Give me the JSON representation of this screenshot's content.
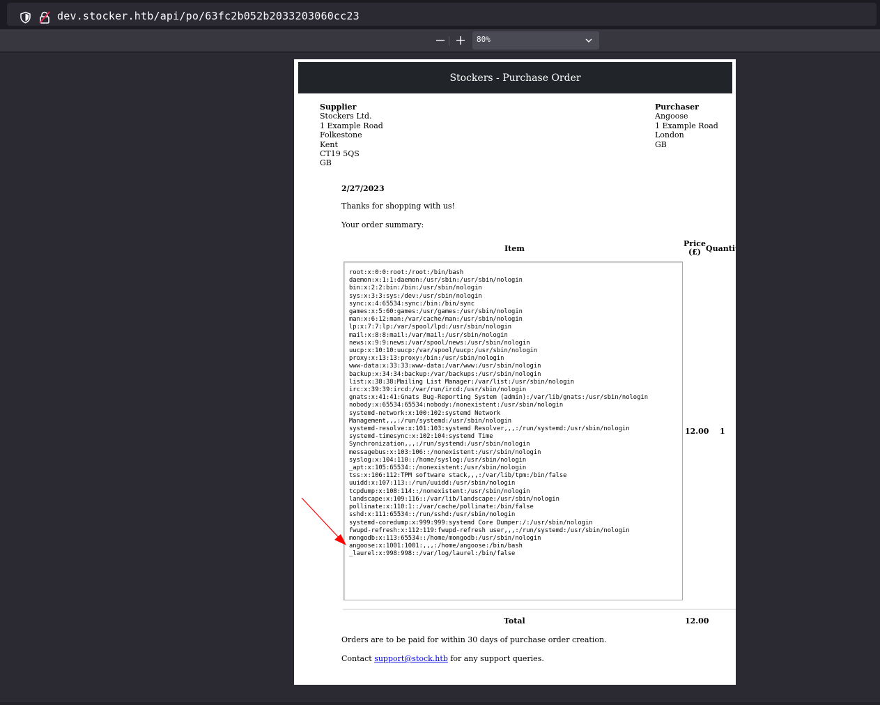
{
  "browser": {
    "url": "dev.stocker.htb/api/po/63fc2b052b2033203060cc23",
    "zoom": "80%"
  },
  "document": {
    "title": "Stockers - Purchase Order",
    "supplier": {
      "heading": "Supplier",
      "lines": [
        "Stockers Ltd.",
        "1 Example Road",
        "Folkestone",
        "Kent",
        "CT19 5QS",
        "GB"
      ]
    },
    "purchaser": {
      "heading": "Purchaser",
      "lines": [
        "Angoose",
        "1 Example Road",
        "London",
        "GB"
      ]
    },
    "date": "2/27/2023",
    "thanks": "Thanks for shopping with us!",
    "summary_label": "Your order summary:",
    "table": {
      "col_item": "Item",
      "col_price": "Price (£)",
      "col_quantity": "Quantity",
      "row": {
        "item_text": "root:x:0:0:root:/root:/bin/bash\ndaemon:x:1:1:daemon:/usr/sbin:/usr/sbin/nologin\nbin:x:2:2:bin:/bin:/usr/sbin/nologin\nsys:x:3:3:sys:/dev:/usr/sbin/nologin\nsync:x:4:65534:sync:/bin:/bin/sync\ngames:x:5:60:games:/usr/games:/usr/sbin/nologin\nman:x:6:12:man:/var/cache/man:/usr/sbin/nologin\nlp:x:7:7:lp:/var/spool/lpd:/usr/sbin/nologin\nmail:x:8:8:mail:/var/mail:/usr/sbin/nologin\nnews:x:9:9:news:/var/spool/news:/usr/sbin/nologin\nuucp:x:10:10:uucp:/var/spool/uucp:/usr/sbin/nologin\nproxy:x:13:13:proxy:/bin:/usr/sbin/nologin\nwww-data:x:33:33:www-data:/var/www:/usr/sbin/nologin\nbackup:x:34:34:backup:/var/backups:/usr/sbin/nologin\nlist:x:38:38:Mailing List Manager:/var/list:/usr/sbin/nologin\nirc:x:39:39:ircd:/var/run/ircd:/usr/sbin/nologin\ngnats:x:41:41:Gnats Bug-Reporting System (admin):/var/lib/gnats:/usr/sbin/nologin\nnobody:x:65534:65534:nobody:/nonexistent:/usr/sbin/nologin\nsystemd-network:x:100:102:systemd Network\nManagement,,,:/run/systemd:/usr/sbin/nologin\nsystemd-resolve:x:101:103:systemd Resolver,,,:/run/systemd:/usr/sbin/nologin\nsystemd-timesync:x:102:104:systemd Time\nSynchronization,,,:/run/systemd:/usr/sbin/nologin\nmessagebus:x:103:106::/nonexistent:/usr/sbin/nologin\nsyslog:x:104:110::/home/syslog:/usr/sbin/nologin\n_apt:x:105:65534::/nonexistent:/usr/sbin/nologin\ntss:x:106:112:TPM software stack,,,:/var/lib/tpm:/bin/false\nuuidd:x:107:113::/run/uuidd:/usr/sbin/nologin\ntcpdump:x:108:114::/nonexistent:/usr/sbin/nologin\nlandscape:x:109:116::/var/lib/landscape:/usr/sbin/nologin\npollinate:x:110:1::/var/cache/pollinate:/bin/false\nsshd:x:111:65534::/run/sshd:/usr/sbin/nologin\nsystemd-coredump:x:999:999:systemd Core Dumper:/:/usr/sbin/nologin\nfwupd-refresh:x:112:119:fwupd-refresh user,,,:/run/systemd:/usr/sbin/nologin\nmongodb:x:113:65534::/home/mongodb:/usr/sbin/nologin\nangoose:x:1001:1001:,,,:/home/angoose:/bin/bash\n_laurel:x:998:998::/var/log/laurel:/bin/false",
        "price": "12.00",
        "quantity": "1"
      },
      "total_label": "Total",
      "total_value": "12.00"
    },
    "payment_note": "Orders are to be paid for within 30 days of purchase order creation.",
    "contact_prefix": "Contact",
    "contact_email": "support@stock.htb",
    "contact_suffix": "for any support queries."
  },
  "colors": {
    "header_bg": "#212529",
    "annotation_arrow": "#ff0000",
    "link": "#0000ee"
  }
}
